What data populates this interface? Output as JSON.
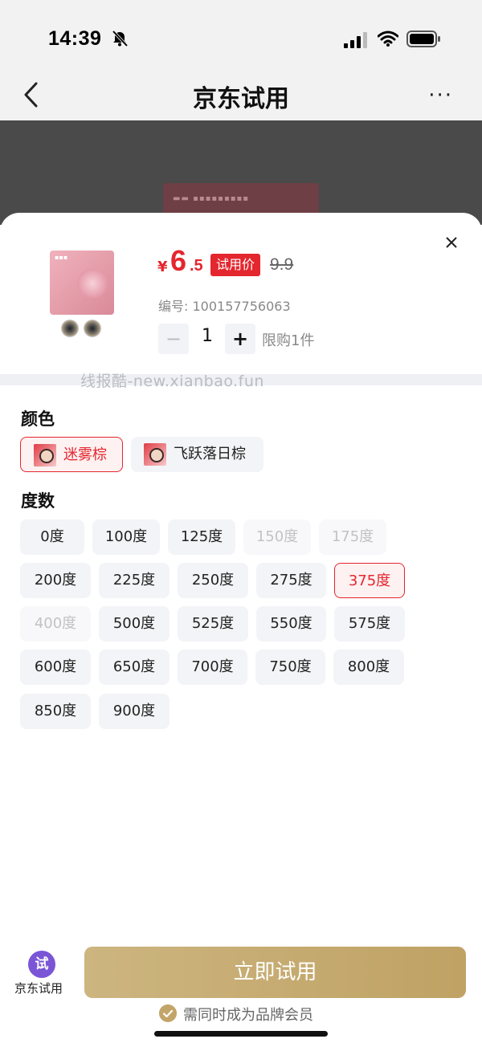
{
  "status_bar": {
    "time": "14:39"
  },
  "nav": {
    "title": "京东试用",
    "more": "···"
  },
  "product": {
    "currency": "¥",
    "price_int": "6",
    "price_dec": ".5",
    "price_tag": "试用价",
    "original_price": "9.9",
    "sku": "编号: 100157756063",
    "minus": "−",
    "quantity": "1",
    "plus": "+",
    "limit": "限购1件"
  },
  "watermark": "线报酷-new.xianbao.fun",
  "color_section": {
    "title": "颜色",
    "options": [
      {
        "label": "迷雾棕",
        "selected": true
      },
      {
        "label": "飞跃落日棕",
        "selected": false
      }
    ]
  },
  "degree_section": {
    "title": "度数",
    "options": [
      {
        "label": "0度",
        "state": "normal"
      },
      {
        "label": "100度",
        "state": "normal"
      },
      {
        "label": "125度",
        "state": "normal"
      },
      {
        "label": "150度",
        "state": "disabled"
      },
      {
        "label": "175度",
        "state": "disabled"
      },
      {
        "label": "200度",
        "state": "normal"
      },
      {
        "label": "225度",
        "state": "normal"
      },
      {
        "label": "250度",
        "state": "normal"
      },
      {
        "label": "275度",
        "state": "normal"
      },
      {
        "label": "375度",
        "state": "selected"
      },
      {
        "label": "400度",
        "state": "disabled"
      },
      {
        "label": "500度",
        "state": "normal"
      },
      {
        "label": "525度",
        "state": "normal"
      },
      {
        "label": "550度",
        "state": "normal"
      },
      {
        "label": "575度",
        "state": "normal"
      },
      {
        "label": "600度",
        "state": "normal"
      },
      {
        "label": "650度",
        "state": "normal"
      },
      {
        "label": "700度",
        "state": "normal"
      },
      {
        "label": "750度",
        "state": "normal"
      },
      {
        "label": "800度",
        "state": "normal"
      },
      {
        "label": "850度",
        "state": "normal"
      },
      {
        "label": "900度",
        "state": "normal"
      }
    ]
  },
  "bottom": {
    "icon_text": "试",
    "label": "京东试用",
    "cta": "立即试用",
    "member_note": "需同时成为品牌会员"
  },
  "colors": {
    "accent": "#e4262e",
    "gold": "#c3a56a",
    "purple": "#7a55d6"
  }
}
